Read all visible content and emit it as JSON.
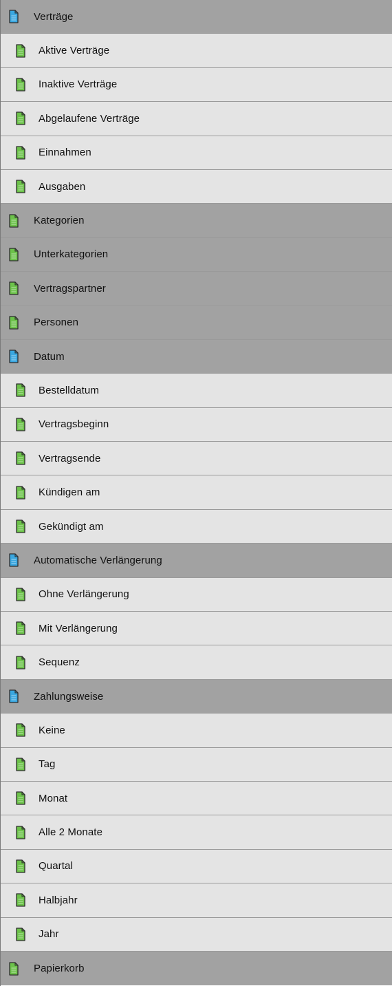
{
  "rows": [
    {
      "label": "Verträge",
      "kind": "group",
      "icon": "folder-doc-icon",
      "color": "#3aa7e0"
    },
    {
      "label": "Aktive Verträge",
      "kind": "child",
      "icon": "doc-icon",
      "color": "#6cc24a"
    },
    {
      "label": "Inaktive Verträge",
      "kind": "child",
      "icon": "doc-icon",
      "color": "#6cc24a"
    },
    {
      "label": "Abgelaufene Verträge",
      "kind": "child",
      "icon": "doc-icon",
      "color": "#6cc24a"
    },
    {
      "label": "Einnahmen",
      "kind": "child",
      "icon": "doc-icon",
      "color": "#6cc24a"
    },
    {
      "label": "Ausgaben",
      "kind": "child",
      "icon": "doc-icon",
      "color": "#6cc24a"
    },
    {
      "label": "Kategorien",
      "kind": "group",
      "icon": "doc-icon",
      "color": "#6cc24a"
    },
    {
      "label": "Unterkategorien",
      "kind": "group",
      "icon": "doc-icon",
      "color": "#6cc24a"
    },
    {
      "label": "Vertragspartner",
      "kind": "group",
      "icon": "doc-icon",
      "color": "#6cc24a"
    },
    {
      "label": "Personen",
      "kind": "group",
      "icon": "doc-icon",
      "color": "#6cc24a"
    },
    {
      "label": "Datum",
      "kind": "group",
      "icon": "folder-doc-icon",
      "color": "#3aa7e0"
    },
    {
      "label": "Bestelldatum",
      "kind": "child",
      "icon": "doc-icon",
      "color": "#6cc24a"
    },
    {
      "label": "Vertragsbeginn",
      "kind": "child",
      "icon": "doc-icon",
      "color": "#6cc24a"
    },
    {
      "label": "Vertragsende",
      "kind": "child",
      "icon": "doc-icon",
      "color": "#6cc24a"
    },
    {
      "label": "Kündigen am",
      "kind": "child",
      "icon": "doc-icon",
      "color": "#6cc24a"
    },
    {
      "label": "Gekündigt am",
      "kind": "child",
      "icon": "doc-icon",
      "color": "#6cc24a"
    },
    {
      "label": "Automatische Verlängerung",
      "kind": "group",
      "icon": "folder-doc-icon",
      "color": "#3aa7e0"
    },
    {
      "label": "Ohne Verlängerung",
      "kind": "child",
      "icon": "doc-icon",
      "color": "#6cc24a"
    },
    {
      "label": "Mit Verlängerung",
      "kind": "child",
      "icon": "doc-icon",
      "color": "#6cc24a"
    },
    {
      "label": "Sequenz",
      "kind": "child",
      "icon": "doc-icon",
      "color": "#6cc24a"
    },
    {
      "label": "Zahlungsweise",
      "kind": "group",
      "icon": "folder-doc-icon",
      "color": "#3aa7e0"
    },
    {
      "label": "Keine",
      "kind": "child",
      "icon": "doc-icon",
      "color": "#6cc24a"
    },
    {
      "label": "Tag",
      "kind": "child",
      "icon": "doc-icon",
      "color": "#6cc24a"
    },
    {
      "label": "Monat",
      "kind": "child",
      "icon": "doc-icon",
      "color": "#6cc24a"
    },
    {
      "label": "Alle 2 Monate",
      "kind": "child",
      "icon": "doc-icon",
      "color": "#6cc24a"
    },
    {
      "label": "Quartal",
      "kind": "child",
      "icon": "doc-icon",
      "color": "#6cc24a"
    },
    {
      "label": "Halbjahr",
      "kind": "child",
      "icon": "doc-icon",
      "color": "#6cc24a"
    },
    {
      "label": "Jahr",
      "kind": "child",
      "icon": "doc-icon",
      "color": "#6cc24a"
    },
    {
      "label": "Papierkorb",
      "kind": "group",
      "icon": "doc-icon",
      "color": "#6cc24a"
    }
  ]
}
